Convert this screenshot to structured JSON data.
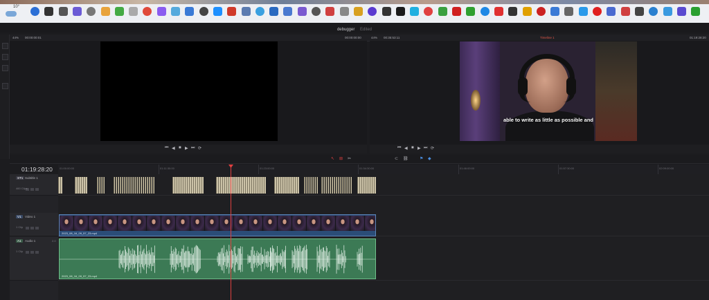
{
  "taskbar": {
    "weather_temp": "10°"
  },
  "app": {
    "project_title": "debugger",
    "project_status": "Edited"
  },
  "source_viewer": {
    "zoom": "44%",
    "timecode_left": "00:00:00:01",
    "timecode_right": "00:00:00:00"
  },
  "program_viewer": {
    "zoom": "44%",
    "timecode_left": "00:35:53:11",
    "timeline_name": "Timeline 1",
    "timecode_right": "01:19:28:20",
    "subtitle_text": "able to write as little as possible and"
  },
  "timeline": {
    "timecode": "01:19:28:20",
    "ruler_ticks": [
      "01:00:00:00",
      "01:11:30:00",
      "01:23:00:00",
      "01:34:30:00",
      "01:46:00:00",
      "01:57:30:00",
      "02:09:00:00"
    ],
    "tracks": [
      {
        "id": "ST1",
        "name": "Subtitle 1",
        "info": "460 Clips"
      },
      {
        "id": "V1",
        "name": "Video 1",
        "info": "1 Clip"
      },
      {
        "id": "A1",
        "name": "Audio 1",
        "channel": "2.0",
        "info": "1 Clip"
      }
    ],
    "video_clip_name": "2023_08_16_09_57_23.mp4",
    "audio_clip_name": "2023_08_16_09_57_23.mp4"
  },
  "colors": {
    "subtitle_clip": "#ccc3a8",
    "video_clip": "#2b4d78",
    "audio_clip": "#3c7a55",
    "playhead": "#e04040",
    "timeline_name": "#e0574a"
  }
}
